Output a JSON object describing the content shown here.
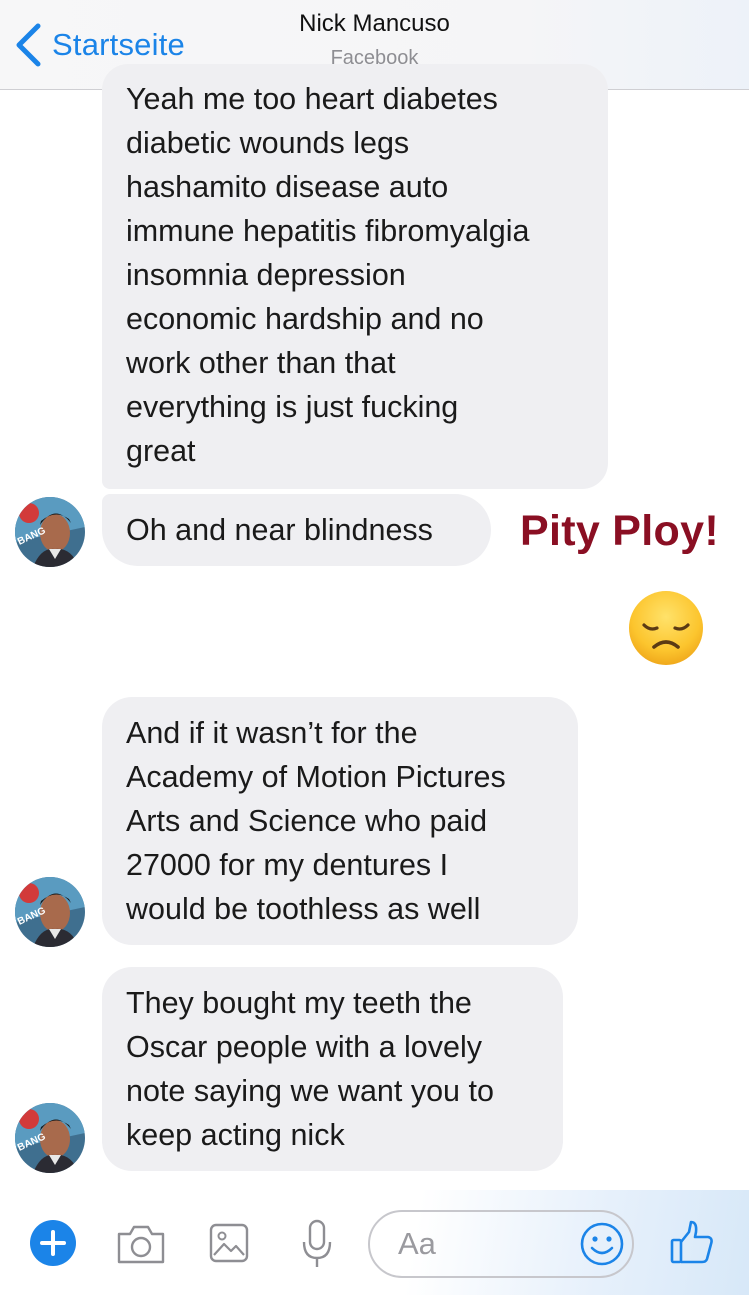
{
  "header": {
    "back_label": "Startseite",
    "contact_name": "Nick Mancuso",
    "contact_subtitle": "Facebook"
  },
  "messages": [
    {
      "text": "Yeah me too heart diabetes\ndiabetic wounds legs\nhashamito disease auto\nimmune hepatitis fibromyalgia\ninsomnia depression\neconomic hardship and no\nwork other than that\neverything is just fucking\ngreat"
    },
    {
      "text": "Oh and near blindness"
    },
    {
      "text": "And if it wasn’t for the\nAcademy of Motion Pictures\nArts and Science who paid\n27000 for my dentures I\nwould be toothless as well"
    },
    {
      "text": "They bought my teeth the\nOscar people with a lovely\nnote saying we want you to\nkeep acting nick"
    }
  ],
  "annotation": {
    "text": "Pity Ploy!",
    "color": "#8a0f23"
  },
  "reaction_emoji": "sad-face-emoji",
  "avatar_badge": "BANG",
  "composer": {
    "placeholder": "Aa",
    "icons": [
      "plus-icon",
      "camera-icon",
      "image-icon",
      "microphone-icon",
      "smiley-icon",
      "thumbs-up-icon"
    ]
  },
  "colors": {
    "accent": "#1b84e8",
    "bubble": "#efeff2"
  }
}
